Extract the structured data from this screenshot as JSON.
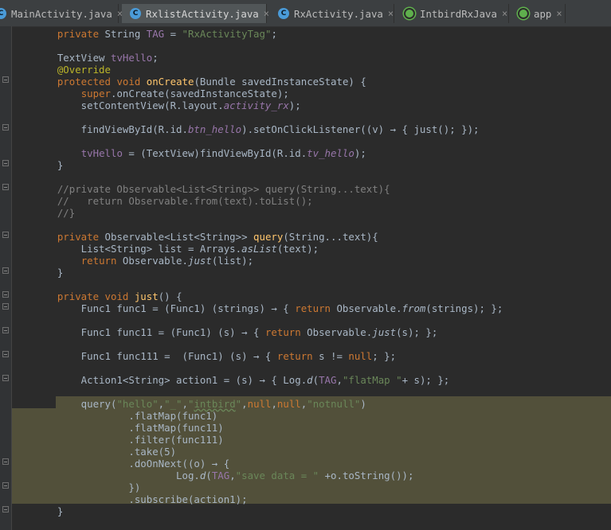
{
  "tabs": [
    {
      "label": "MainActivity.java",
      "icon": "java-class-icon",
      "active": false
    },
    {
      "label": "RxlistActivity.java",
      "icon": "java-class-icon",
      "active": true
    },
    {
      "label": "RxActivity.java",
      "icon": "java-class-icon",
      "active": false
    },
    {
      "label": "IntbirdRxJava",
      "icon": "gradle-module-icon",
      "active": false
    },
    {
      "label": "app",
      "icon": "gradle-module-icon",
      "active": false
    }
  ],
  "icons": {
    "close": "×",
    "class_letter": "C"
  },
  "code_lines": [
    "    private String TAG = \"RxActivityTag\";",
    "",
    "    TextView tvHello;",
    "    @Override",
    "    protected void onCreate(Bundle savedInstanceState) {",
    "        super.onCreate(savedInstanceState);",
    "        setContentView(R.layout.activity_rx);",
    "",
    "        findViewById(R.id.btn_hello).setOnClickListener((v) → { just(); });",
    "",
    "        tvHello = (TextView)findViewById(R.id.tv_hello);",
    "    }",
    "",
    "    //private Observable<List<String>> query(String...text){",
    "    //   return Observable.from(text).toList();",
    "    //}",
    "",
    "    private Observable<List<String>> query(String...text){",
    "        List<String> list = Arrays.asList(text);",
    "        return Observable.just(list);",
    "    }",
    "",
    "    private void just() {",
    "        Func1 func1 = (Func1) (strings) → { return Observable.from(strings); };",
    "",
    "        Func1 func11 = (Func1) (s) → { return Observable.just(s); };",
    "",
    "        Func1 func111 =  (Func1) (s) → { return s != null; };",
    "",
    "        Action1<String> action1 = (s) → { Log.d(TAG,\"flatMap \"+ s); };",
    "",
    "        query(\"hello\",\"_\",\"intbird\",null,null,\"notnull\")",
    "                .flatMap(func1)",
    "                .flatMap(func11)",
    "                .filter(func111)",
    "                .take(5)",
    "                .doOnNext((o) → {",
    "                        Log.d(TAG,\"save data = \" +o.toString());",
    "                })",
    "                .subscribe(action1);",
    "    }"
  ],
  "colors": {
    "background": "#2b2b2b",
    "keyword": "#cc7832",
    "string": "#6a8759",
    "field": "#9876aa",
    "comment": "#808080",
    "annotation": "#bbb529",
    "method_decl": "#ffc66d",
    "selection": "#52503a"
  }
}
